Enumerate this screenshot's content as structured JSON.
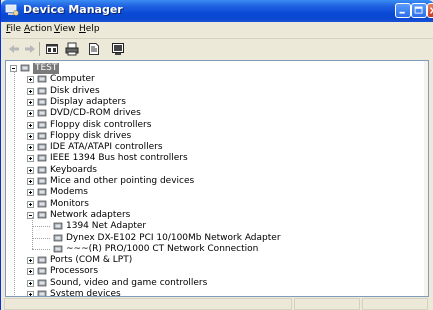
{
  "window": {
    "title": "Device Manager"
  },
  "menu": [
    {
      "label": "File",
      "ul": "F",
      "rest": "ile"
    },
    {
      "label": "Action",
      "ul": "A",
      "rest": "ction"
    },
    {
      "label": "View",
      "ul": "V",
      "rest": "iew"
    },
    {
      "label": "Help",
      "ul": "H",
      "rest": "elp"
    }
  ],
  "toolbar": {
    "icons": [
      "back-arrow-icon",
      "forward-arrow-icon",
      "properties-grid-icon",
      "print-icon",
      "help-document-icon",
      "computer-screen-icon"
    ]
  },
  "tree": {
    "root_label": "TEST",
    "items": [
      {
        "label": "Computer",
        "icon": "computer-icon",
        "expanded": false
      },
      {
        "label": "Disk drives",
        "icon": "disk-drive-icon",
        "expanded": false
      },
      {
        "label": "Display adapters",
        "icon": "display-adapter-icon",
        "expanded": false
      },
      {
        "label": "DVD/CD-ROM drives",
        "icon": "cdrom-icon",
        "expanded": false
      },
      {
        "label": "Floppy disk controllers",
        "icon": "floppy-controller-icon",
        "expanded": false
      },
      {
        "label": "Floppy disk drives",
        "icon": "floppy-drive-icon",
        "expanded": false
      },
      {
        "label": "IDE ATA/ATAPI controllers",
        "icon": "ide-controller-icon",
        "expanded": false
      },
      {
        "label": "IEEE 1394 Bus host controllers",
        "icon": "ieee1394-icon",
        "expanded": false
      },
      {
        "label": "Keyboards",
        "icon": "keyboard-icon",
        "expanded": false
      },
      {
        "label": "Mice and other pointing devices",
        "icon": "mouse-icon",
        "expanded": false
      },
      {
        "label": "Modems",
        "icon": "modem-icon",
        "expanded": false
      },
      {
        "label": "Monitors",
        "icon": "monitor-icon",
        "expanded": false
      },
      {
        "label": "Network adapters",
        "icon": "network-adapter-icon",
        "expanded": true,
        "children": [
          {
            "label": "1394 Net Adapter",
            "icon": "network-card-icon"
          },
          {
            "label": "Dynex DX-E102 PCI 10/100Mb Network Adapter",
            "icon": "network-card-icon"
          },
          {
            "label": "~~~(R) PRO/1000 CT Network Connection",
            "icon": "network-card-icon"
          }
        ]
      },
      {
        "label": "Ports (COM & LPT)",
        "icon": "port-icon",
        "expanded": false
      },
      {
        "label": "Processors",
        "icon": "processor-icon",
        "expanded": false
      },
      {
        "label": "Sound, video and game controllers",
        "icon": "sound-icon",
        "expanded": false
      },
      {
        "label": "System devices",
        "icon": "system-device-icon",
        "expanded": false
      }
    ]
  },
  "colors": {
    "titlebar": "#0a4ad6",
    "window_bg": "#ece9d8",
    "selection": "#7a7a7a"
  }
}
